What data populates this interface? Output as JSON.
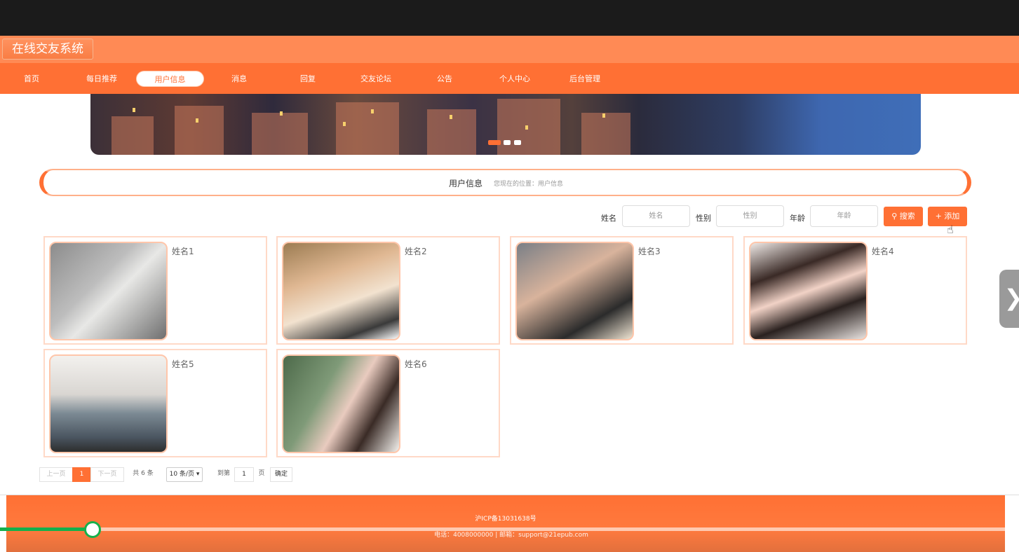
{
  "app": {
    "title": "在线交友系统"
  },
  "nav": {
    "items": [
      "首页",
      "每日推荐",
      "用户信息",
      "消息",
      "回复",
      "交友论坛",
      "公告",
      "个人中心",
      "后台管理"
    ],
    "active_index": 2
  },
  "carousel": {
    "dots": 3,
    "active_dot": 0
  },
  "breadcrumb": {
    "title": "用户信息",
    "path": "您现在的位置：用户信息"
  },
  "filters": {
    "name_label": "姓名",
    "name_placeholder": "姓名",
    "gender_label": "性别",
    "gender_placeholder": "性别",
    "age_label": "年龄",
    "age_placeholder": "年龄",
    "search_button": "搜索",
    "add_button": "添加"
  },
  "users": [
    {
      "name": "姓名1"
    },
    {
      "name": "姓名2"
    },
    {
      "name": "姓名3"
    },
    {
      "name": "姓名4"
    },
    {
      "name": "姓名5"
    },
    {
      "name": "姓名6"
    }
  ],
  "pagination": {
    "prev": "上一页",
    "current": "1",
    "next": "下一页",
    "total": "共 6 条",
    "page_size": "10 条/页",
    "goto_label": "到第",
    "goto_value": "1",
    "page_suffix": "页",
    "confirm": "确定"
  },
  "footer": {
    "icp": "沪ICP备13031638号",
    "contact": "电话：4008000000 | 邮箱：support@21epub.com"
  },
  "colors": {
    "primary": "#ff7034",
    "light": "#ff8a55"
  }
}
